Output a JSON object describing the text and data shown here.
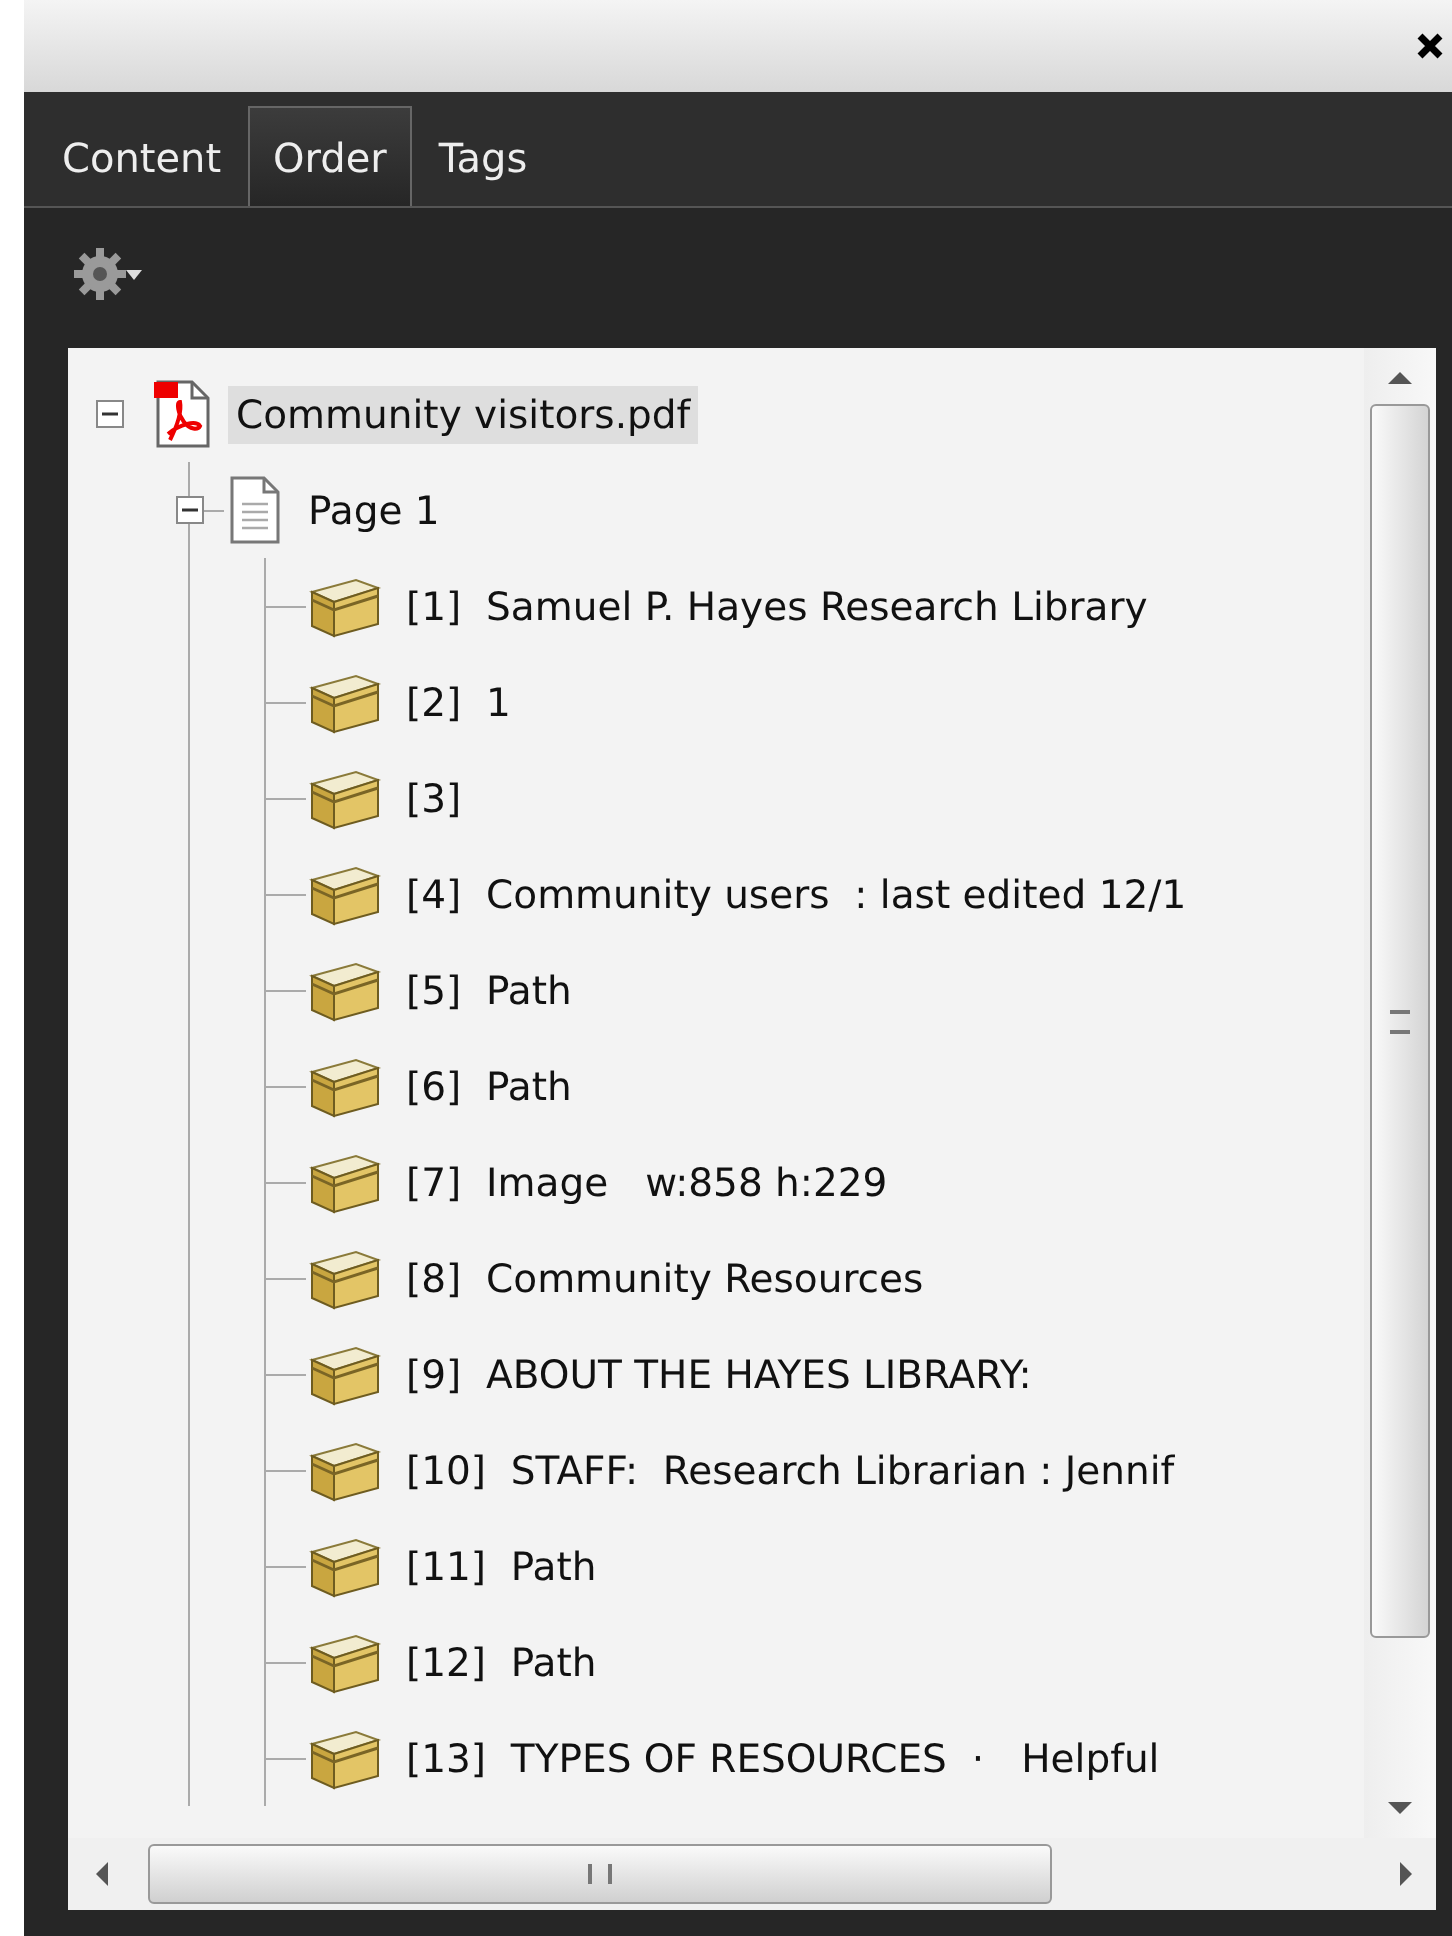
{
  "tabs": [
    {
      "label": "Content",
      "selected": false
    },
    {
      "label": "Order",
      "selected": true
    },
    {
      "label": "Tags",
      "selected": false
    }
  ],
  "tree": [
    {
      "kind": "document",
      "label": "Community visitors.pdf",
      "expanded": true,
      "selected": true,
      "children": [
        {
          "kind": "page",
          "label": "Page 1",
          "expanded": true,
          "selected": false,
          "children": [
            {
              "kind": "container",
              "label": "[1]  Samuel P. Hayes Research Library",
              "selected": false
            },
            {
              "kind": "container",
              "label": "[2]  1",
              "selected": false
            },
            {
              "kind": "container",
              "label": "[3]",
              "selected": false
            },
            {
              "kind": "container",
              "label": "[4]  Community users  : last edited 12/1",
              "selected": false
            },
            {
              "kind": "container",
              "label": "[5]  Path",
              "selected": false
            },
            {
              "kind": "container",
              "label": "[6]  Path",
              "selected": false
            },
            {
              "kind": "container",
              "label": "[7]  Image   w:858 h:229",
              "selected": false
            },
            {
              "kind": "container",
              "label": "[8]  Community Resources",
              "selected": false
            },
            {
              "kind": "container",
              "label": "[9]  ABOUT THE HAYES LIBRARY:",
              "selected": false
            },
            {
              "kind": "container",
              "label": "[10]  STAFF:  Research Librarian : Jennif",
              "selected": false
            },
            {
              "kind": "container",
              "label": "[11]  Path",
              "selected": false
            },
            {
              "kind": "container",
              "label": "[12]  Path",
              "selected": false
            },
            {
              "kind": "container",
              "label": "[13]  TYPES OF RESOURCES  ·   Helpful",
              "selected": false
            }
          ]
        }
      ]
    }
  ]
}
